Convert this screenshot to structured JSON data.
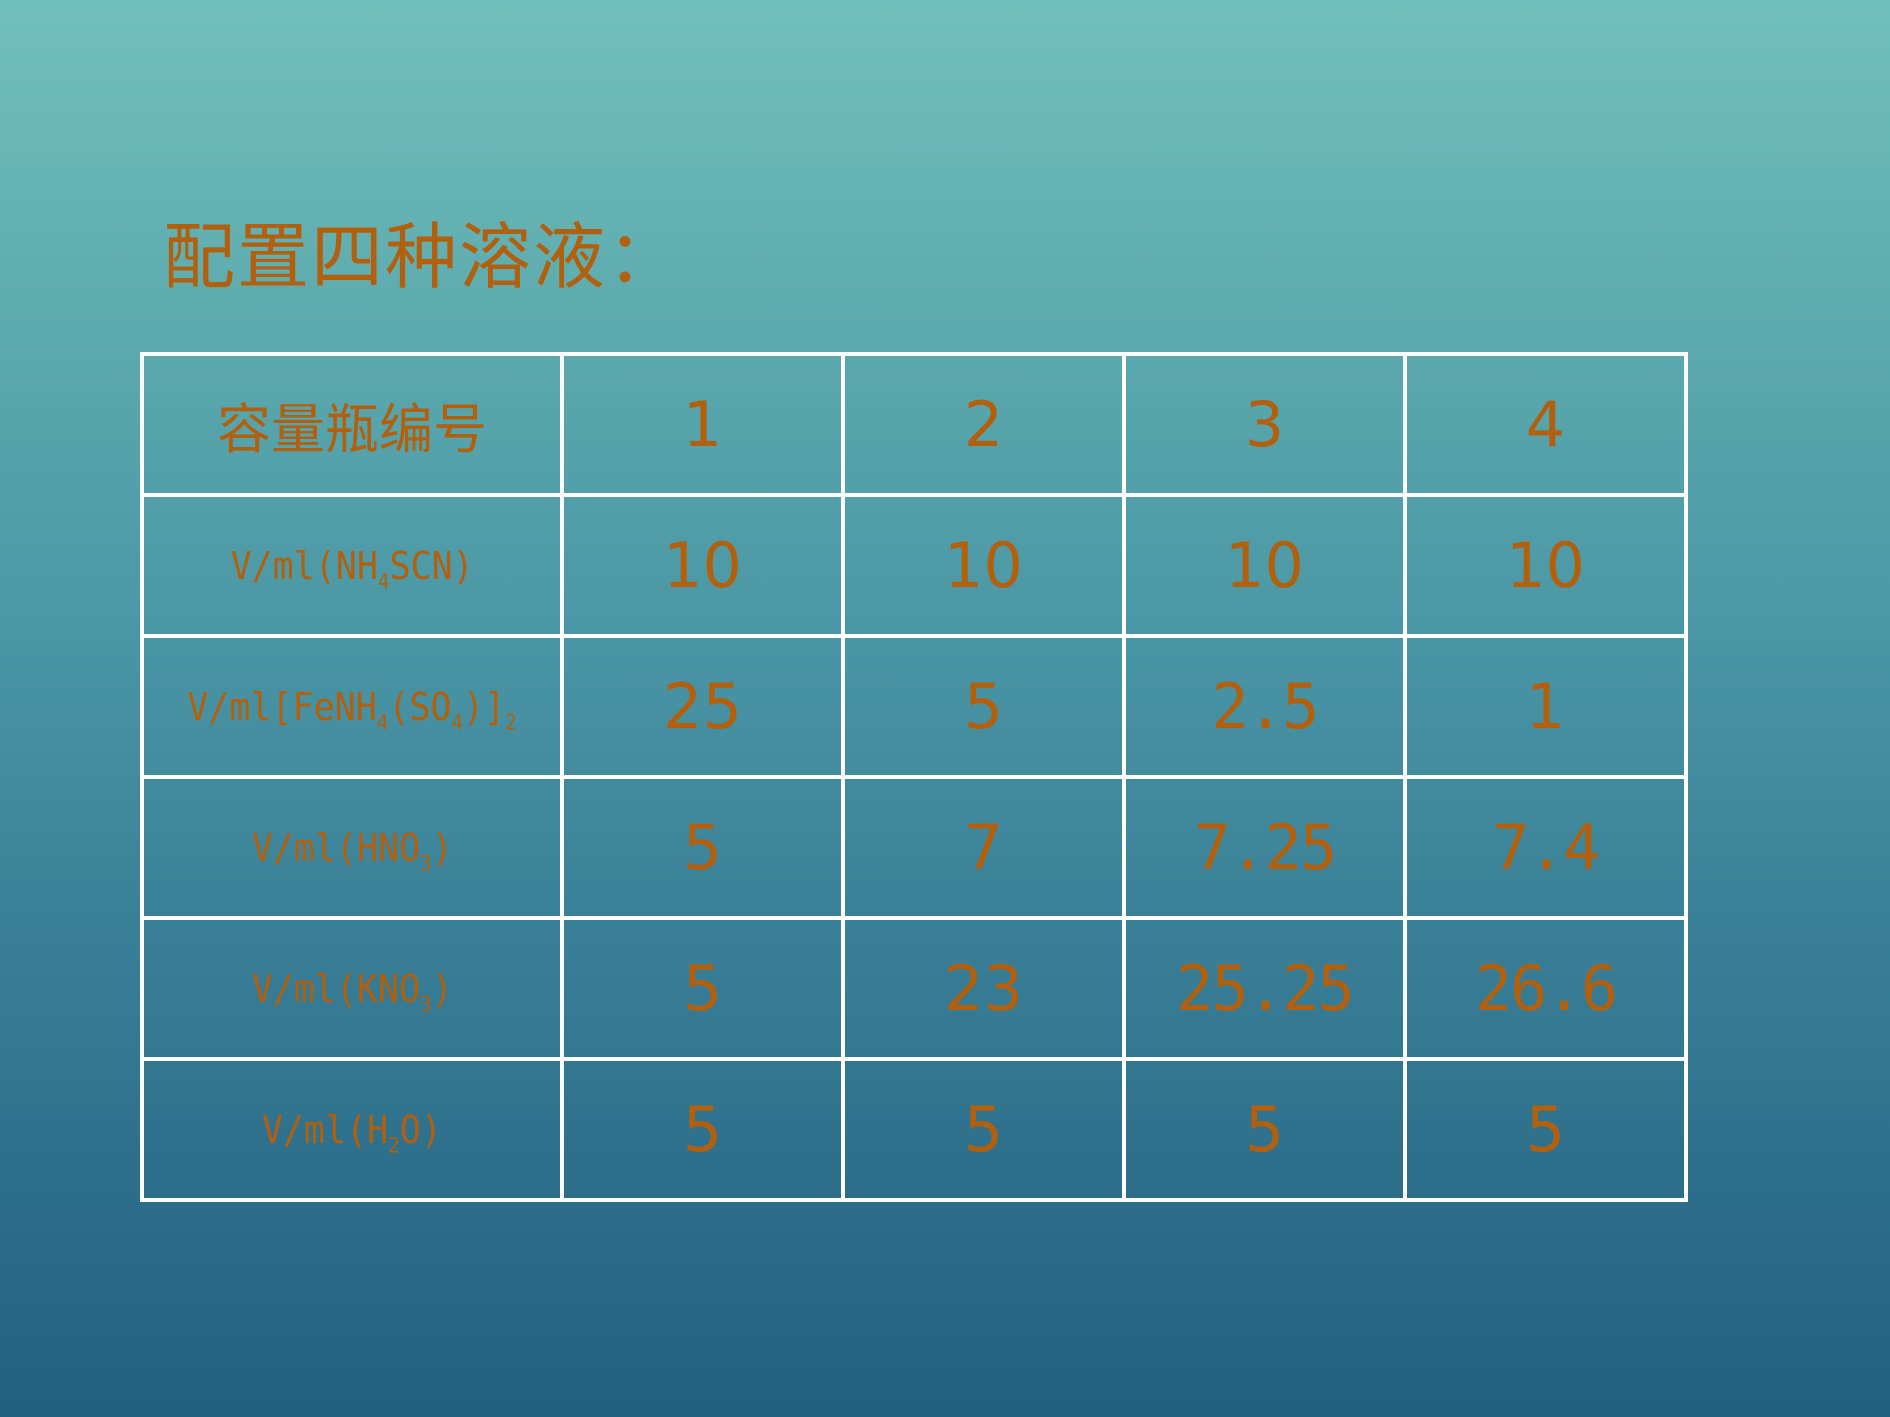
{
  "slide": {
    "title": "配置四种溶液："
  },
  "table": {
    "header": {
      "label": "容量瓶编号",
      "columns": [
        "1",
        "2",
        "3",
        "4"
      ]
    },
    "rows": [
      {
        "label_parts": [
          "V/ml(NH",
          "4",
          "SCN)"
        ],
        "values": [
          "10",
          "10",
          "10",
          "10"
        ]
      },
      {
        "label_parts": [
          "V/ml[FeNH",
          "4",
          "(SO",
          "4",
          ")]",
          "2"
        ],
        "values": [
          "25",
          "5",
          "2.5",
          "1"
        ]
      },
      {
        "label_parts": [
          "V/ml(HNO",
          "3",
          ")"
        ],
        "values": [
          "5",
          "7",
          "7.25",
          "7.4"
        ]
      },
      {
        "label_parts": [
          "V/ml(KNO",
          "3",
          ")"
        ],
        "values": [
          "5",
          "23",
          "25.25",
          "26.6"
        ]
      },
      {
        "label_parts": [
          "V/ml(H",
          "2",
          "O)"
        ],
        "values": [
          "5",
          "5",
          "5",
          "5"
        ]
      }
    ]
  }
}
